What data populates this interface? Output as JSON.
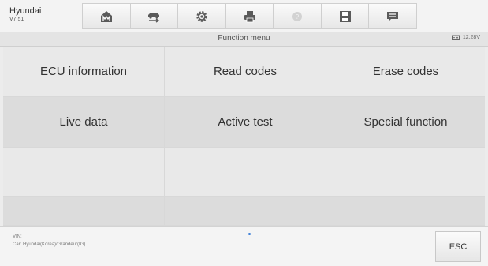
{
  "header": {
    "brand": "Hyundai",
    "version": "V7.51"
  },
  "toolbar": {
    "icons": [
      "home-icon",
      "vehicle-swap-icon",
      "settings-icon",
      "print-icon",
      "help-icon",
      "save-icon",
      "data-logging-icon"
    ]
  },
  "subheader": {
    "title": "Function menu",
    "voltage": "12.28V"
  },
  "menu": {
    "items": [
      "ECU information",
      "Read codes",
      "Erase codes",
      "Live data",
      "Active test",
      "Special function"
    ]
  },
  "footer": {
    "vin": "VIN:",
    "car": "Car: Hyundai(Korea)/Grandeur(IG)",
    "esc_label": "ESC"
  },
  "colors": {
    "accent": "#3d7fd8"
  }
}
